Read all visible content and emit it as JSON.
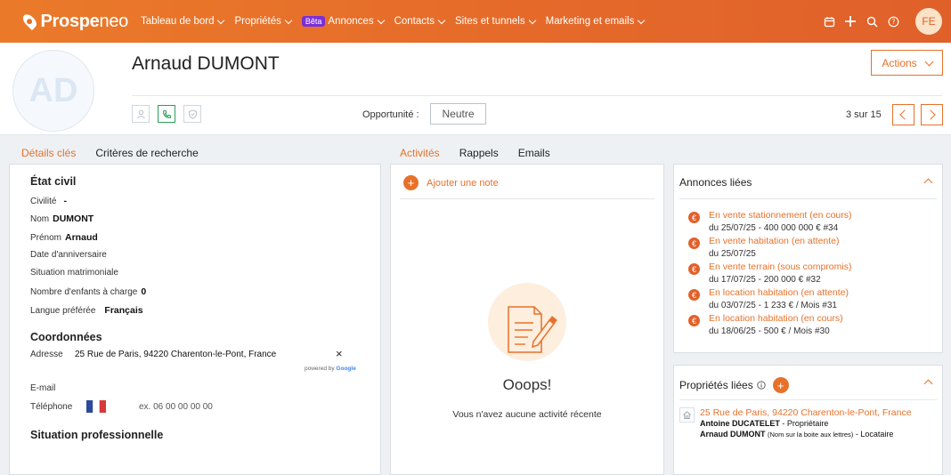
{
  "app": {
    "logo": {
      "bold": "Prospe",
      "light": "neo"
    },
    "nav": [
      {
        "label": "Tableau de bord"
      },
      {
        "label": "Propriétés"
      },
      {
        "label": "Annonces",
        "badge": "Bêta"
      },
      {
        "label": "Contacts"
      },
      {
        "label": "Sites et tunnels"
      },
      {
        "label": "Marketing et emails"
      }
    ],
    "user_initials": "FE",
    "accent_color": "#e8712a"
  },
  "contact": {
    "initials": "AD",
    "name": "Arnaud DUMONT",
    "opportunity_label": "Opportunité :",
    "opportunity_value": "Neutre",
    "actions_label": "Actions",
    "pager_text": "3 sur 15"
  },
  "left_tabs": [
    "Détails clés",
    "Critères de recherche"
  ],
  "mid_tabs": [
    "Activités",
    "Rappels",
    "Emails"
  ],
  "etat_civil": {
    "title": "État civil",
    "civilite_label": "Civilité",
    "civilite_value": "-",
    "nom_label": "Nom",
    "nom_value": "DUMONT",
    "prenom_label": "Prénom",
    "prenom_value": "Arnaud",
    "birthday_label": "Date d'anniversaire",
    "marital_label": "Situation matrimoniale",
    "children_label": "Nombre d'enfants à charge",
    "children_value": "0",
    "lang_label": "Langue préférée",
    "lang_value": "Français"
  },
  "coordonnees": {
    "title": "Coordonnées",
    "address_label": "Adresse",
    "address_value": "25 Rue de Paris, 94220 Charenton-le-Pont, France",
    "clear_symbol": "×",
    "powered_by": "powered by",
    "google": "Google",
    "email_label": "E-mail",
    "phone_label": "Téléphone",
    "phone_placeholder": "ex. 06 00 00 00 00"
  },
  "situation_pro": {
    "title": "Situation professionnelle"
  },
  "activities": {
    "add_note": "Ajouter une note",
    "empty_title": "Ooops!",
    "empty_sub": "Vous n'avez aucune activité récente"
  },
  "annonces": {
    "title": "Annonces liées",
    "items": [
      {
        "title": "En vente stationnement (en cours)",
        "sub": "du 25/07/25 - 400 000 000 € #34"
      },
      {
        "title": "En vente habitation (en attente)",
        "sub": "du 25/07/25"
      },
      {
        "title": "En vente terrain (sous compromis)",
        "sub": "du 17/07/25 - 200 000 € #32"
      },
      {
        "title": "En location habitation (en attente)",
        "sub": "du 03/07/25 - 1 233 € / Mois #31"
      },
      {
        "title": "En location habitation (en cours)",
        "sub": "du 18/06/25 - 500 € / Mois #30"
      }
    ]
  },
  "proprietes": {
    "title": "Propriétés liées",
    "address": "25 Rue de Paris, 94220 Charenton-le-Pont, France",
    "owner_name": "Antoine DUCATELET",
    "owner_role": "- Propriétaire",
    "tenant_name": "Arnaud DUMONT",
    "tenant_note": "(Nom sur la boite aux lettres)",
    "tenant_role": "- Locataire"
  }
}
